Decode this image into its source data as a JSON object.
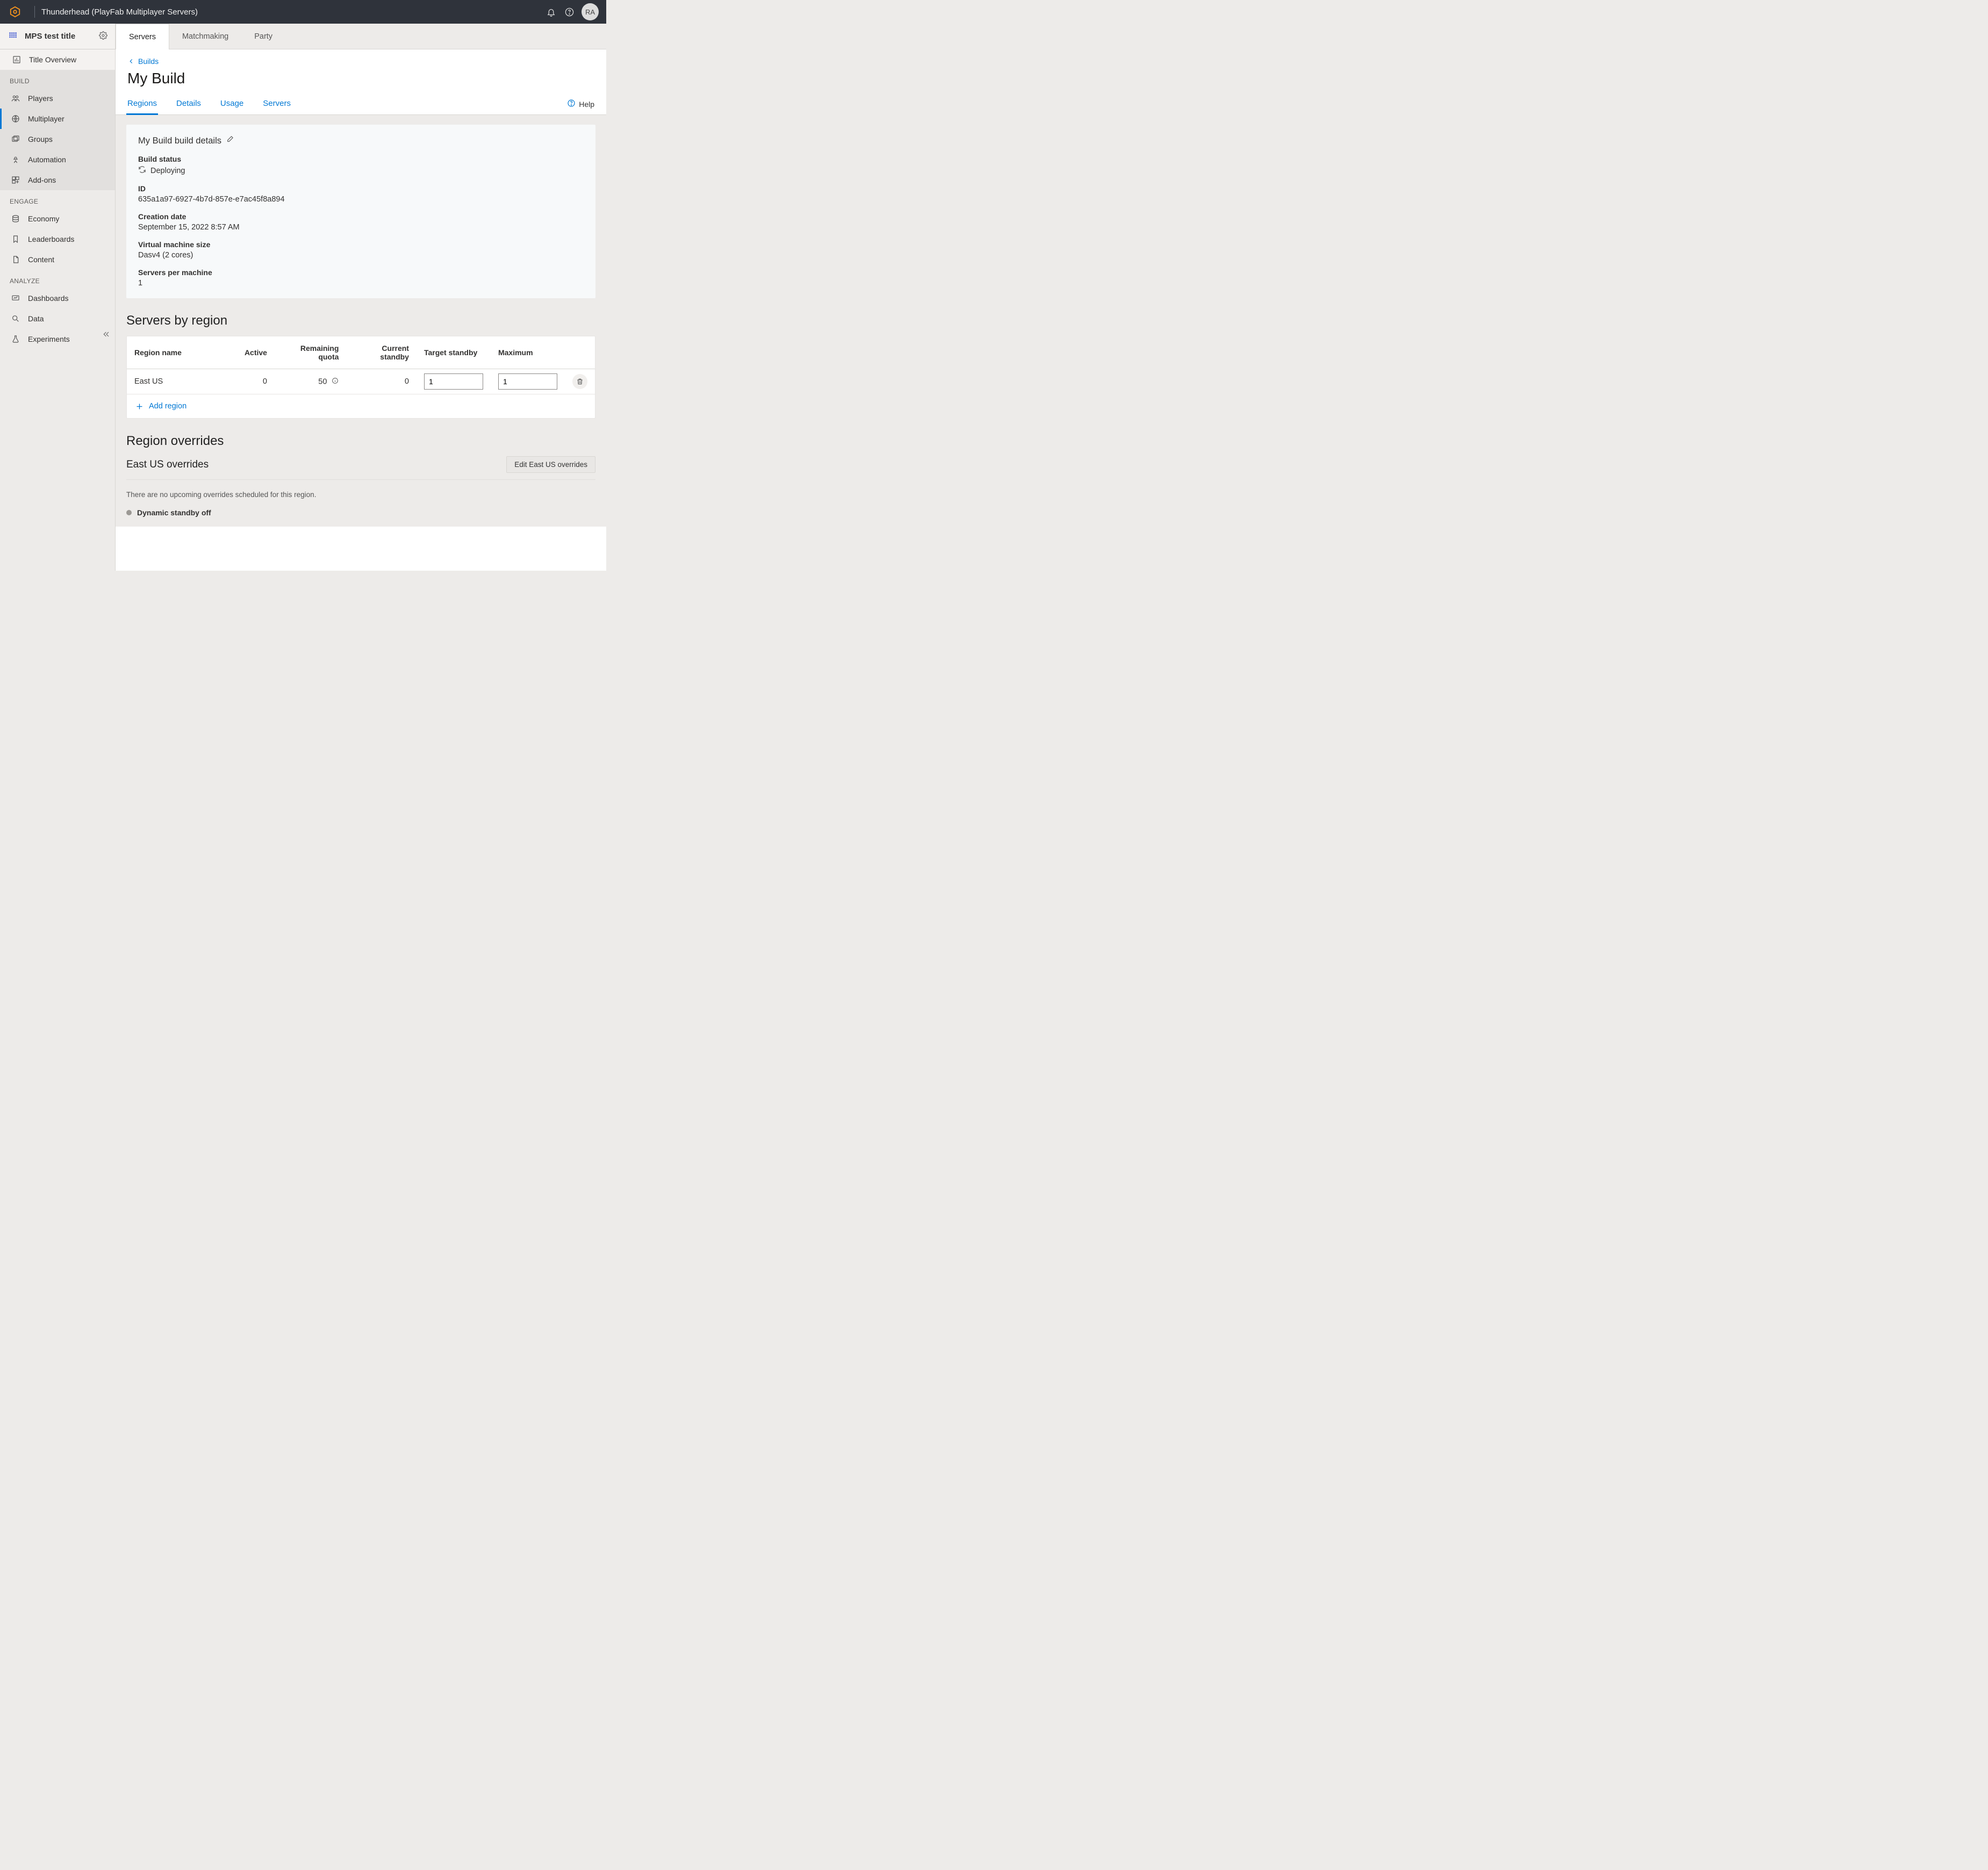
{
  "topbar": {
    "title": "Thunderhead (PlayFab Multiplayer Servers)",
    "avatar": "RA"
  },
  "sidebar": {
    "title": "MPS test title",
    "items": {
      "overview": "Title Overview",
      "players": "Players",
      "multiplayer": "Multiplayer",
      "groups": "Groups",
      "automation": "Automation",
      "addons": "Add-ons",
      "economy": "Economy",
      "leaderboards": "Leaderboards",
      "content": "Content",
      "dashboards": "Dashboards",
      "data": "Data",
      "experiments": "Experiments"
    },
    "sections": {
      "build": "BUILD",
      "engage": "ENGAGE",
      "analyze": "ANALYZE"
    }
  },
  "toptabs": {
    "servers": "Servers",
    "matchmaking": "Matchmaking",
    "party": "Party"
  },
  "breadcrumb": {
    "label": "Builds"
  },
  "page_title": "My Build",
  "subtabs": {
    "regions": "Regions",
    "details": "Details",
    "usage": "Usage",
    "servers": "Servers"
  },
  "help_label": "Help",
  "build_details": {
    "title": "My Build build details",
    "fields": {
      "status_label": "Build status",
      "status_value": "Deploying",
      "id_label": "ID",
      "id_value": "635a1a97-6927-4b7d-857e-e7ac45f8a894",
      "created_label": "Creation date",
      "created_value": "September 15, 2022 8:57 AM",
      "vm_label": "Virtual machine size",
      "vm_value": "Dasv4 (2 cores)",
      "spm_label": "Servers per machine",
      "spm_value": "1"
    }
  },
  "servers_by_region": {
    "title": "Servers by region",
    "headers": {
      "region": "Region name",
      "active": "Active",
      "quota": "Remaining quota",
      "standby": "Current standby",
      "target": "Target standby",
      "max": "Maximum"
    },
    "row": {
      "region": "East US",
      "active": "0",
      "quota": "50",
      "standby": "0",
      "target": "1",
      "max": "1"
    },
    "add_region": "Add region"
  },
  "region_overrides": {
    "title": "Region overrides",
    "east_title": "East US overrides",
    "edit_btn": "Edit East US overrides",
    "none_msg": "There are no upcoming overrides scheduled for this region.",
    "dynamic_off": "Dynamic standby off"
  }
}
